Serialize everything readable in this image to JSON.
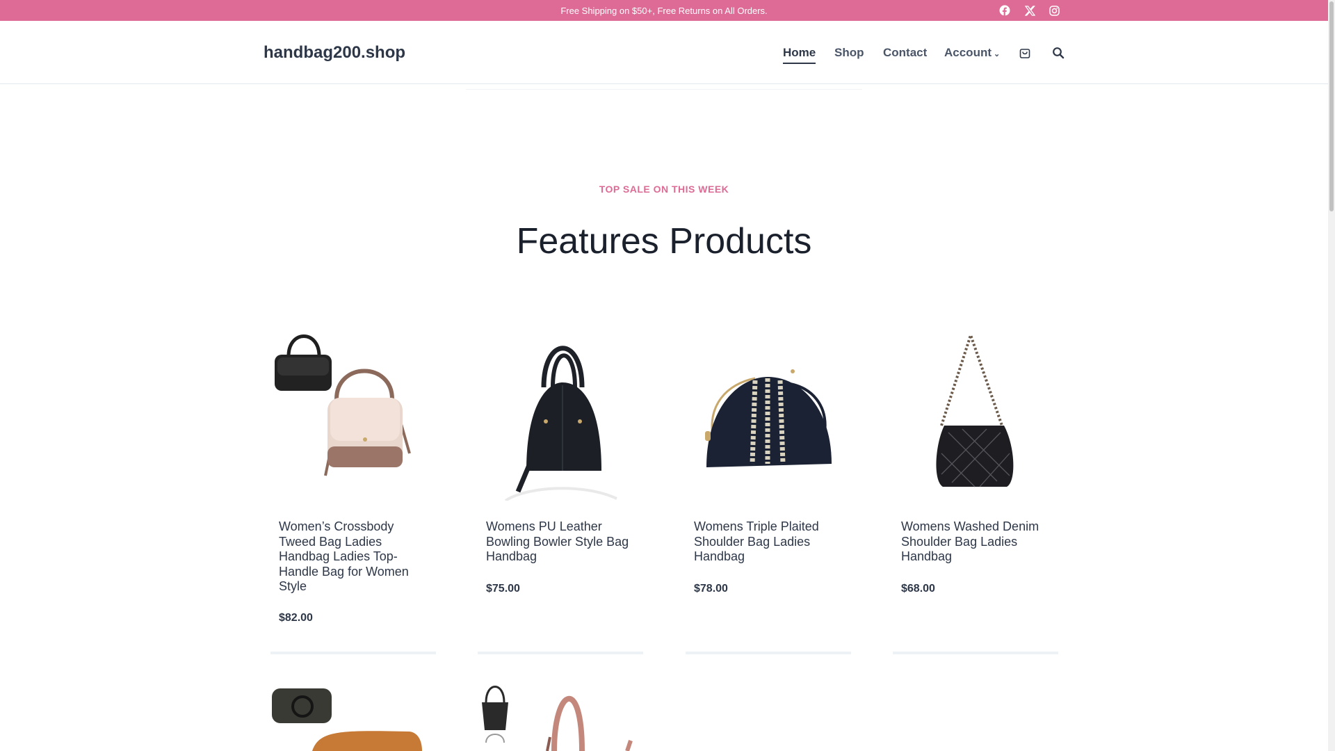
{
  "topbar": {
    "message": "Free Shipping on $50+, Free Returns on All Orders.",
    "social": [
      "facebook-icon",
      "x-icon",
      "instagram-icon"
    ],
    "bg_color": "#dd6b95"
  },
  "header": {
    "logo": "handbag200.shop",
    "nav": [
      {
        "label": "Home",
        "active": true
      },
      {
        "label": "Shop"
      },
      {
        "label": "Contact"
      },
      {
        "label": "Account",
        "has_dropdown": true
      }
    ],
    "icons": [
      "cart-icon",
      "search-icon"
    ]
  },
  "section": {
    "subtitle": "TOP SALE ON THIS WEEK",
    "title": "Features Products"
  },
  "products": [
    {
      "name": "Women’s Crossbody Tweed Bag Ladies Handbag Ladies Top-Handle Bag for Women Style",
      "price": "$82.00"
    },
    {
      "name": "Womens PU Leather Bowling Bowler Style Bag Handbag",
      "price": "$75.00"
    },
    {
      "name": "Womens Triple Plaited Shoulder Bag Ladies Handbag",
      "price": "$78.00"
    },
    {
      "name": "Womens Washed Denim Shoulder Bag Ladies Handbag",
      "price": "$68.00"
    }
  ],
  "colors": {
    "accent": "#dd6b95",
    "text": "#2d3748"
  }
}
